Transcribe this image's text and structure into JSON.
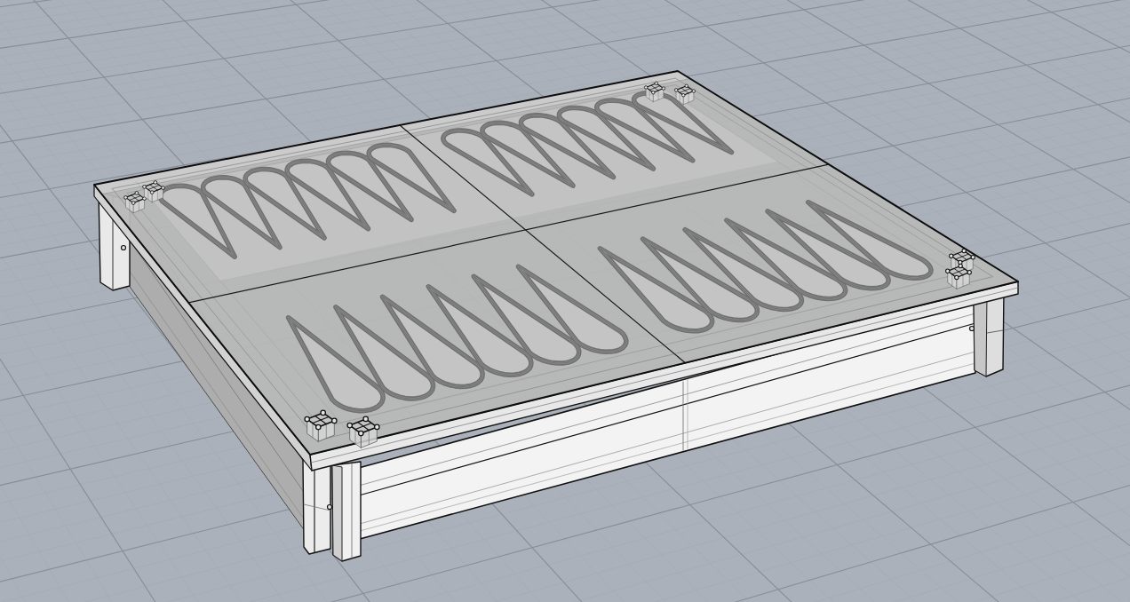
{
  "viewport": {
    "grid": true,
    "ghosted": true
  },
  "model": {
    "kind": "backgammon-board"
  }
}
